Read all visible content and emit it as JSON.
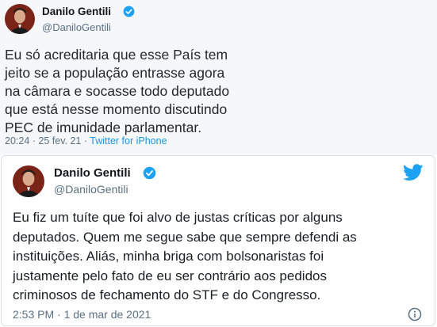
{
  "top_tweet": {
    "name": "Danilo Gentili",
    "handle": "@DaniloGentili",
    "lines": [
      "Eu só acreditaria que esse País tem",
      "jeito se a população entrasse agora",
      "na câmara e socasse todo deputado",
      "que está nesse momento discutindo",
      "PEC de imunidade parlamentar."
    ],
    "time_date": "20:24 · 25 fev. 21 · ",
    "source": "Twitter for iPhone"
  },
  "bottom_tweet": {
    "name": "Danilo Gentili",
    "handle": "@DaniloGentili",
    "lines": [
      "Eu fiz um tuíte que foi alvo de justas críticas por alguns",
      "deputados. Quem me segue sabe que sempre defendi as",
      "instituições. Aliás, minha briga com bolsonaristas foi",
      "justamente pelo fato de eu ser contrário aos pedidos",
      "criminosos de fechamento do STF e do Congresso."
    ],
    "timestamp": "2:53 PM · 1 de mar de 2021"
  },
  "colors": {
    "verified": "#1da1f2",
    "twitter_bird": "#1da1f2",
    "link": "#1b95e0"
  },
  "icons": [
    "verified-badge-icon",
    "twitter-bird-icon",
    "info-icon"
  ]
}
